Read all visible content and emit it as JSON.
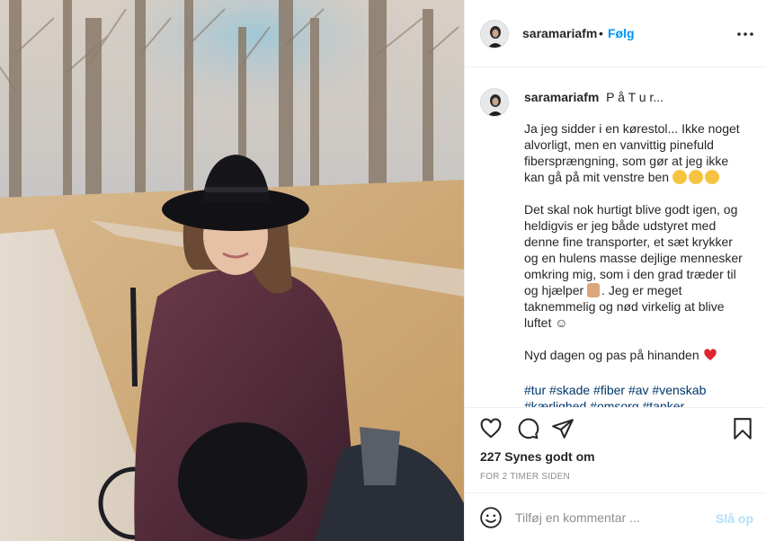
{
  "post": {
    "username": "saramariafm",
    "follow_label": "Følg",
    "separator": "•",
    "more_icon": "ellipsis-icon"
  },
  "caption": {
    "username": "saramariafm",
    "title": "P å T u r...",
    "paragraph1": "Ja jeg sidder i en kørestol... Ikke noget alvorligt, men en vanvittig pinefuld fibersprængning, som gør at jeg ikke kan gå på mit venstre ben",
    "paragraph1_emojis": [
      "grimacing-emoji",
      "flushed-emoji",
      "zany-emoji"
    ],
    "paragraph2": "Det skal nok hurtigt blive godt igen, og heldigvis er jeg både udstyret med denne fine transporter, et sæt krykker og en hulens masse dejlige mennesker omkring mig, som i den grad træder til og hjælper",
    "paragraph2_emoji": "folded-hands-emoji",
    "paragraph2_end": ". Jeg er meget taknemmelig og nød virkelig at blive luftet ☺",
    "paragraph3": "Nyd dagen og pas på hinanden",
    "paragraph3_emoji": "red-heart-emoji",
    "hashtags": "#tur #skade #fiber #av #venskab #kærlighed #omsorg #tanker"
  },
  "actions": {
    "like_icon": "heart-icon",
    "comment_icon": "comment-icon",
    "share_icon": "paper-plane-icon",
    "save_icon": "bookmark-icon"
  },
  "likes": "227 Synes godt om",
  "timestamp": "FOR 2 TIMER SIDEN",
  "comment": {
    "placeholder": "Tilføj en kommentar ...",
    "post_label": "Slå op",
    "emoji_icon": "smiley-icon"
  },
  "colors": {
    "follow": "#0095f6",
    "hashtag": "#00376b",
    "post_disabled": "#b2dffc",
    "heart": "#ed4956"
  }
}
